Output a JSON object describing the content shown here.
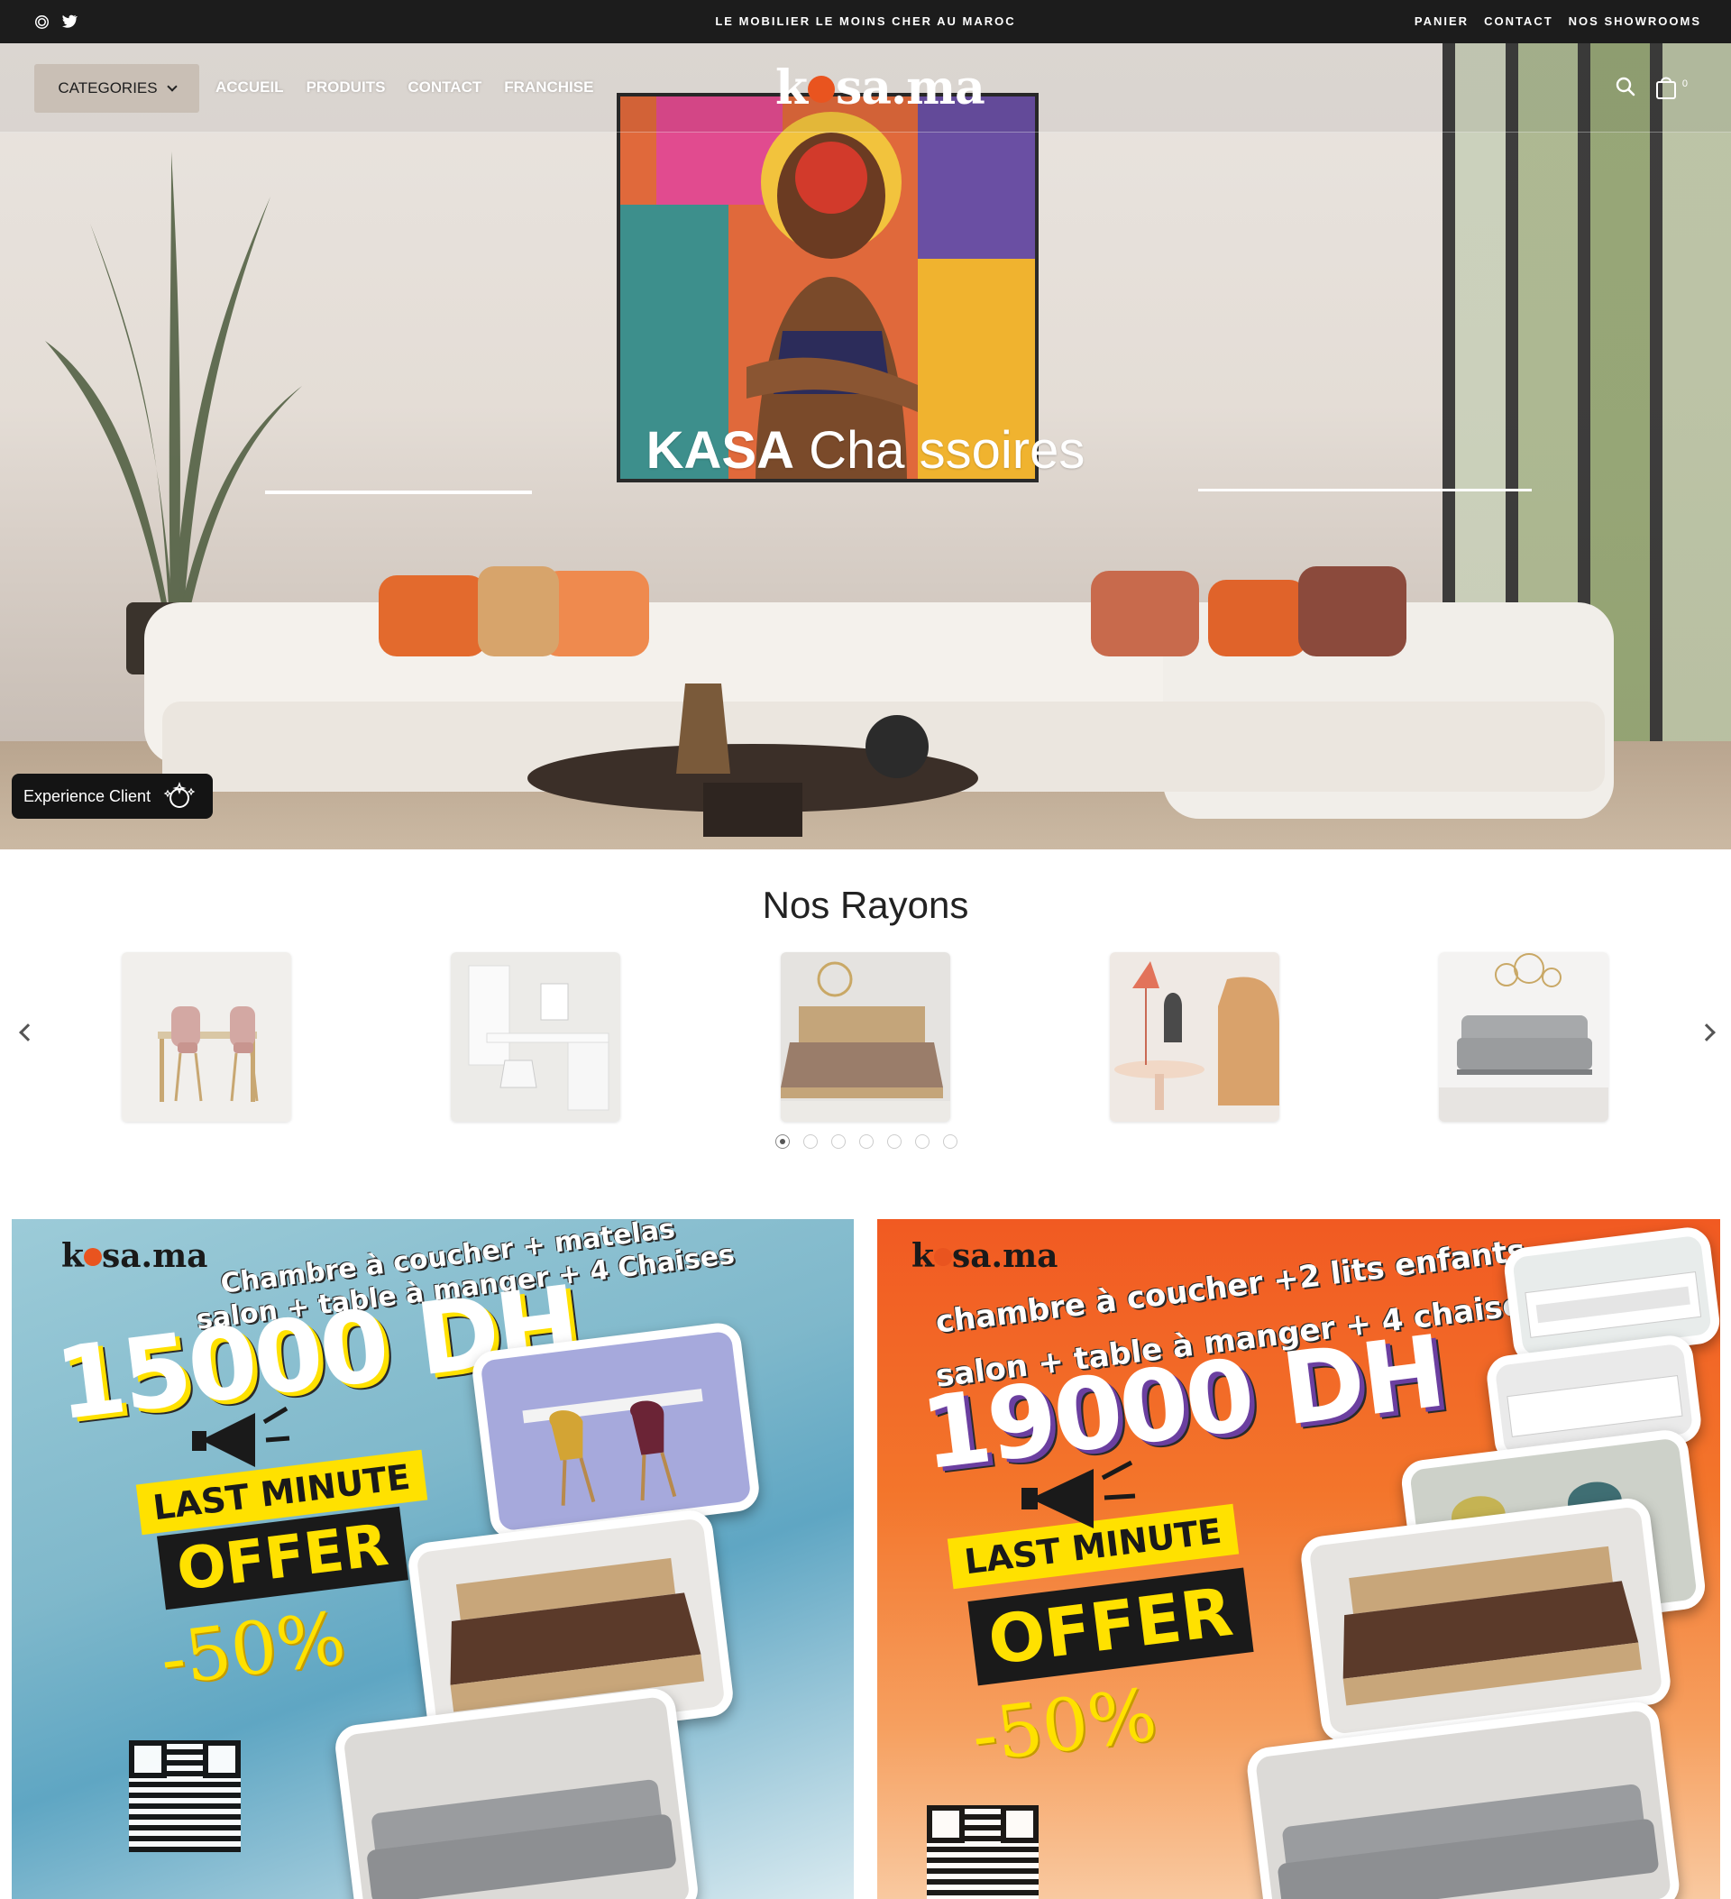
{
  "topbar": {
    "announcement": "LE MOBILIER LE MOINS CHER AU MAROC",
    "links": [
      "PANIER",
      "CONTACT",
      "NOS SHOWROOMS"
    ],
    "social_icons": [
      "instagram-icon",
      "twitter-icon"
    ]
  },
  "header": {
    "categories_label": "CATEGORIES",
    "nav": [
      "ACCUEIL",
      "PRODUITS",
      "CONTACT",
      "FRANCHISE"
    ],
    "logo_before": "k",
    "logo_after": "sa.ma",
    "cart_count": "0"
  },
  "hero": {
    "title_bold": "KASA",
    "title_light": "Cha  ssoires",
    "experience_label": "Experience Client"
  },
  "rayons": {
    "title": "Nos Rayons",
    "items": [
      "salle-a-manger",
      "bureau",
      "chambre",
      "decoration",
      "salon"
    ],
    "page_count": 7,
    "active_page": 1
  },
  "promos": [
    {
      "logo_before": "k",
      "logo_after": "sa.ma",
      "line1": "Chambre à coucher + matelas",
      "line2": "salon + table à manger + 4 Chaises",
      "price": "15000 DH",
      "last_minute": "LAST MINUTE",
      "offer": "OFFER",
      "discount": "-50%"
    },
    {
      "logo_before": "k",
      "logo_after": "sa.ma",
      "line1": "chambre à coucher +2 lits enfants",
      "line2": "salon + table à manger + 4 chaises",
      "price": "19000 DH",
      "last_minute": "LAST MINUTE",
      "offer": "OFFER",
      "discount": "-50%"
    }
  ],
  "colors": {
    "topbar_bg": "#1c1c1c",
    "brand_orange": "#e9541f",
    "promo_yellow": "#ffe100"
  }
}
